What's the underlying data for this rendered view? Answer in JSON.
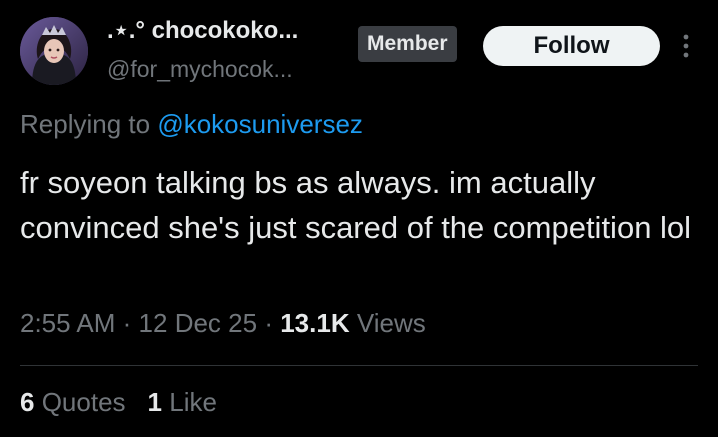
{
  "author": {
    "display_name": ".⋆.° chocokoko...",
    "handle": "@for_mychocok...",
    "badge": "Member",
    "avatar_icon": "profile-avatar"
  },
  "actions": {
    "follow_label": "Follow",
    "more_icon": "more-vertical-icon"
  },
  "reply": {
    "prefix": "Replying to",
    "mention": "@kokosuniversez"
  },
  "tweet": {
    "text": "fr soyeon talking bs as always. im actually convinced she's just scared of the competition lol"
  },
  "meta": {
    "time": "2:55 AM",
    "separator": "·",
    "date": "12 Dec 25",
    "views_count": "13.1K",
    "views_label": "Views"
  },
  "engagement": {
    "quotes_count": "6",
    "quotes_label": "Quotes",
    "likes_count": "1",
    "likes_label": "Like"
  },
  "colors": {
    "background": "#000000",
    "text": "#e7e9ea",
    "muted": "#71767b",
    "link": "#1d9bf0",
    "divider": "#2f3336"
  }
}
